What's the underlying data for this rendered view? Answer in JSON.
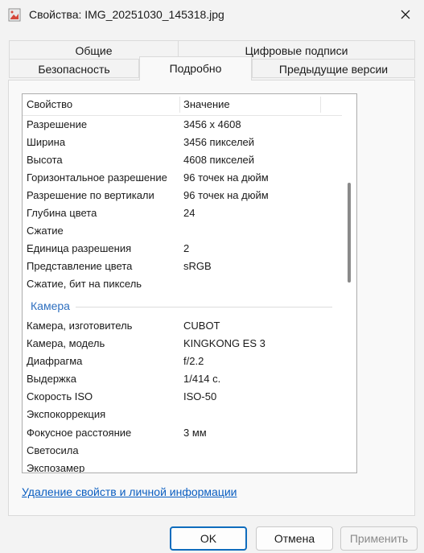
{
  "window": {
    "title": "Свойства: IMG_20251030_145318.jpg"
  },
  "tabs": [
    {
      "label": "Общие"
    },
    {
      "label": "Цифровые подписи"
    },
    {
      "label": "Безопасность"
    },
    {
      "label": "Подробно"
    },
    {
      "label": "Предыдущие версии"
    }
  ],
  "list": {
    "headers": {
      "property": "Свойство",
      "value": "Значение"
    },
    "rows_image": [
      {
        "p": "Разрешение",
        "v": "3456 x 4608"
      },
      {
        "p": "Ширина",
        "v": "3456 пикселей"
      },
      {
        "p": "Высота",
        "v": "4608 пикселей"
      },
      {
        "p": "Горизонтальное разрешение",
        "v": "96 точек на дюйм"
      },
      {
        "p": "Разрешение по вертикали",
        "v": "96 точек на дюйм"
      },
      {
        "p": "Глубина цвета",
        "v": "24"
      },
      {
        "p": "Сжатие",
        "v": ""
      },
      {
        "p": "Единица разрешения",
        "v": "2"
      },
      {
        "p": "Представление цвета",
        "v": "sRGB"
      },
      {
        "p": "Сжатие, бит на пиксель",
        "v": ""
      }
    ],
    "group_camera": "Камера",
    "rows_camera": [
      {
        "p": "Камера, изготовитель",
        "v": "CUBOT"
      },
      {
        "p": "Камера, модель",
        "v": "KINGKONG ES 3"
      },
      {
        "p": "Диафрагма",
        "v": "f/2.2"
      },
      {
        "p": "Выдержка",
        "v": "1/414 с."
      },
      {
        "p": "Скорость ISO",
        "v": "ISO-50"
      },
      {
        "p": "Экспокоррекция",
        "v": ""
      },
      {
        "p": "Фокусное расстояние",
        "v": "3 мм"
      },
      {
        "p": "Светосила",
        "v": ""
      },
      {
        "p": "Экспозамер",
        "v": ""
      }
    ]
  },
  "link": {
    "remove": "Удаление свойств и личной информации"
  },
  "buttons": {
    "ok": "OK",
    "cancel": "Отмена",
    "apply": "Применить"
  }
}
